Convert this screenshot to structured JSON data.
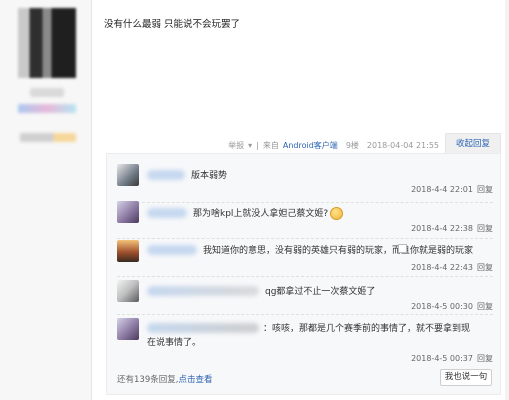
{
  "post": {
    "content": "没有什么最弱 只能说不会玩罢了",
    "meta": {
      "report": "举报",
      "separator": "|",
      "from_prefix": "来自",
      "client": "Android客户端",
      "floor": "9楼",
      "datetime": "2018-04-04 21:55"
    },
    "collapse_label": "收起回复"
  },
  "replies": [
    {
      "text": "版本弱势",
      "time": "2018-4-4 22:01",
      "reply_label": "回复"
    },
    {
      "text": "那为啥kpl上就没人拿妲己蔡文姬?",
      "time": "2018-4-4 22:38",
      "reply_label": "回复"
    },
    {
      "text": "我知道你的意思，没有弱的英雄只有弱的玩家，而且你就是弱的玩家",
      "time": "2018-4-4 22:43",
      "reply_label": "回复"
    },
    {
      "text": "qg都拿过不止一次蔡文姬了",
      "time": "2018-4-5 00:30",
      "reply_label": "回复"
    },
    {
      "text_line1": "：咳咳，那都是几个赛季前的事情了，就不要拿到现",
      "text_line2": "在说事情了。",
      "time": "2018-4-5 00:37",
      "reply_label": "回复"
    }
  ],
  "footer": {
    "more_prefix": "还有139条回复,",
    "view_link": "点击查看",
    "say_button": "我也说一句"
  },
  "colors": {
    "link": "#2d64b3",
    "reply_bg": "#f7f8fa"
  }
}
